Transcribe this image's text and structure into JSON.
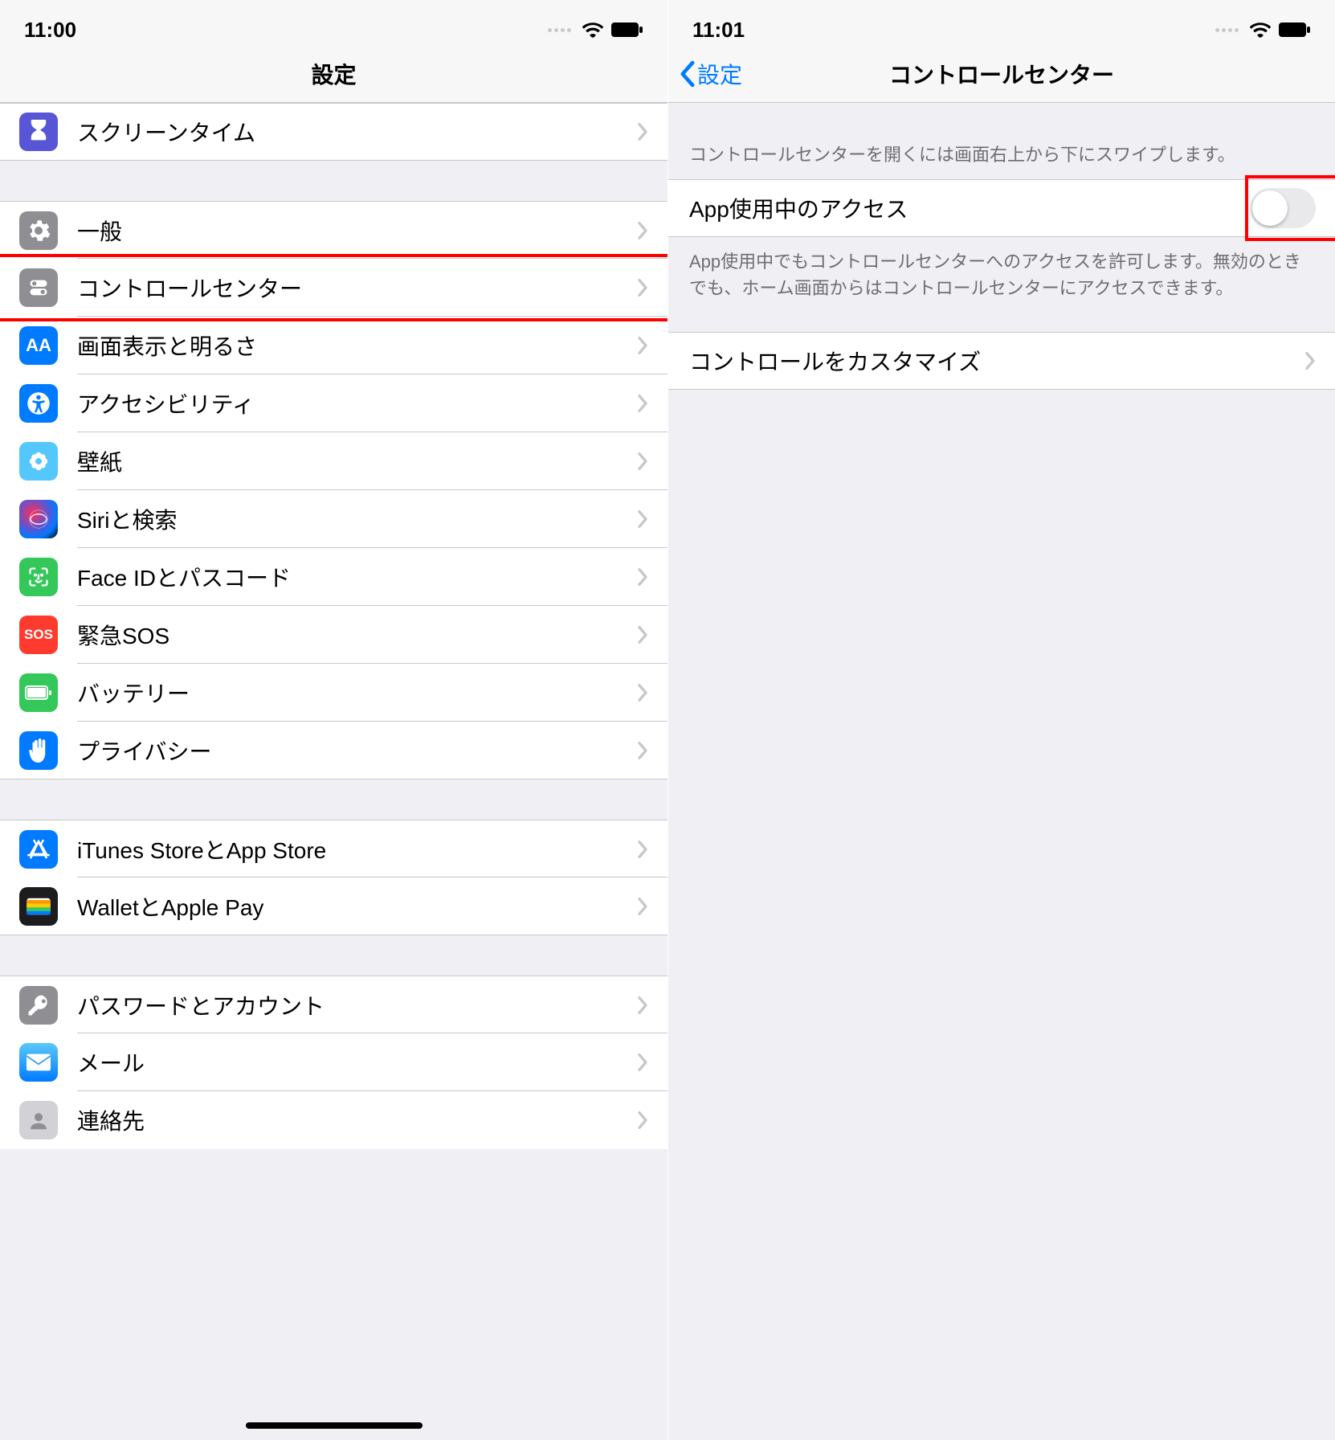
{
  "left": {
    "statusbar": {
      "time": "11:00"
    },
    "nav": {
      "title": "設定"
    },
    "rows": [
      {
        "label": "スクリーンタイム",
        "icon": "hourglass-icon",
        "bg": "bg-purple"
      }
    ],
    "group2": [
      {
        "label": "一般",
        "icon": "gear-icon",
        "bg": "bg-gray"
      },
      {
        "label": "コントロールセンター",
        "icon": "toggles-icon",
        "bg": "bg-gray",
        "highlighted": true
      },
      {
        "label": "画面表示と明るさ",
        "icon": "aa-icon",
        "bg": "bg-blue"
      },
      {
        "label": "アクセシビリティ",
        "icon": "accessibility-icon",
        "bg": "bg-blue"
      },
      {
        "label": "壁紙",
        "icon": "flower-icon",
        "bg": "bg-cyan"
      },
      {
        "label": "Siriと検索",
        "icon": "siri-icon",
        "bg": "bg-siri"
      },
      {
        "label": "Face IDとパスコード",
        "icon": "faceid-icon",
        "bg": "bg-green"
      },
      {
        "label": "緊急SOS",
        "icon": "sos-icon",
        "bg": "bg-red"
      },
      {
        "label": "バッテリー",
        "icon": "battery-icon",
        "bg": "bg-green"
      },
      {
        "label": "プライバシー",
        "icon": "hand-icon",
        "bg": "bg-blue"
      }
    ],
    "group3": [
      {
        "label": "iTunes StoreとApp Store",
        "icon": "appstore-icon",
        "bg": "bg-blue"
      },
      {
        "label": "WalletとApple Pay",
        "icon": "wallet-icon",
        "bg": "bg-dark"
      }
    ],
    "group4": [
      {
        "label": "パスワードとアカウント",
        "icon": "key-icon",
        "bg": "bg-gray"
      },
      {
        "label": "メール",
        "icon": "mail-icon",
        "bg": "bg-blue"
      },
      {
        "label": "連絡先",
        "icon": "contacts-icon",
        "bg": "bg-gray"
      }
    ]
  },
  "right": {
    "statusbar": {
      "time": "11:01"
    },
    "nav": {
      "back": "設定",
      "title": "コントロールセンター"
    },
    "caption1": "コントロールセンターを開くには画面右上から下にスワイプします。",
    "toggle_row": {
      "label": "App使用中のアクセス",
      "on": false
    },
    "caption2": "App使用中でもコントロールセンターへのアクセスを許可します。無効のときでも、ホーム画面からはコントロールセンターにアクセスできます。",
    "customize_row": {
      "label": "コントロールをカスタマイズ"
    }
  }
}
